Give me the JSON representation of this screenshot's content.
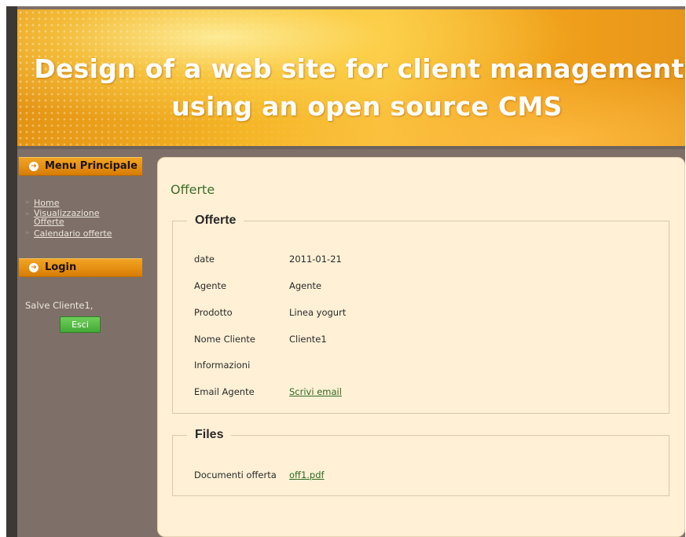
{
  "header": {
    "title_line1": "Design of a web site for client management",
    "title_line2": "using an open source CMS"
  },
  "sidebar": {
    "menu_heading": "Menu Principale",
    "menu_items": [
      {
        "label": "Home"
      },
      {
        "label": "Visualizzazione Offerte"
      },
      {
        "label": "Calendario offerte"
      }
    ],
    "login_heading": "Login",
    "greeting": "Salve Cliente1,",
    "logout_label": "Esci"
  },
  "content": {
    "page_title": "Offerte",
    "offer_section": {
      "legend": "Offerte",
      "fields": [
        {
          "label": "date",
          "value": "2011-01-21"
        },
        {
          "label": "Agente",
          "value": "Agente"
        },
        {
          "label": "Prodotto",
          "value": "Linea yogurt"
        },
        {
          "label": "Nome Cliente",
          "value": "Cliente1"
        },
        {
          "label": "Informazioni",
          "value": ""
        },
        {
          "label": "Email Agente",
          "value": "Scrivi email"
        }
      ]
    },
    "files_section": {
      "legend": "Files",
      "label": "Documenti offerta",
      "file_link": "off1.pdf"
    }
  },
  "colors": {
    "sidebar_bg": "#7e7068",
    "content_bg": "#fff0d6",
    "accent_orange": "#e48d10",
    "title_green": "#3f6f2a",
    "button_green": "#43a937"
  },
  "icons": {
    "sidebar_heading": "arrow-circle-right-icon",
    "menu_bullet": "chevron-right-icon"
  }
}
